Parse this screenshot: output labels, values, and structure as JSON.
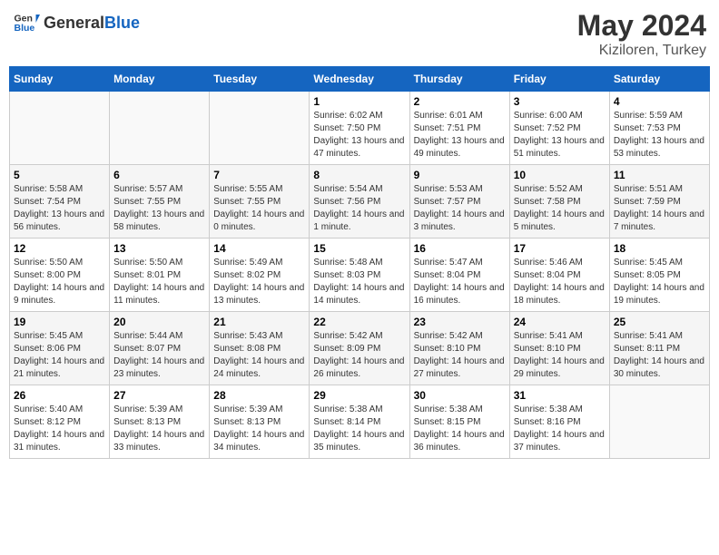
{
  "header": {
    "logo": {
      "general": "General",
      "blue": "Blue"
    },
    "title": "May 2024",
    "location": "Kiziloren, Turkey"
  },
  "weekdays": [
    "Sunday",
    "Monday",
    "Tuesday",
    "Wednesday",
    "Thursday",
    "Friday",
    "Saturday"
  ],
  "weeks": [
    {
      "shade": false,
      "days": [
        {
          "num": "",
          "empty": true
        },
        {
          "num": "",
          "empty": true
        },
        {
          "num": "",
          "empty": true
        },
        {
          "num": "1",
          "sunrise": "6:02 AM",
          "sunset": "7:50 PM",
          "daylight": "13 hours and 47 minutes."
        },
        {
          "num": "2",
          "sunrise": "6:01 AM",
          "sunset": "7:51 PM",
          "daylight": "13 hours and 49 minutes."
        },
        {
          "num": "3",
          "sunrise": "6:00 AM",
          "sunset": "7:52 PM",
          "daylight": "13 hours and 51 minutes."
        },
        {
          "num": "4",
          "sunrise": "5:59 AM",
          "sunset": "7:53 PM",
          "daylight": "13 hours and 53 minutes."
        }
      ]
    },
    {
      "shade": true,
      "days": [
        {
          "num": "5",
          "sunrise": "5:58 AM",
          "sunset": "7:54 PM",
          "daylight": "13 hours and 56 minutes."
        },
        {
          "num": "6",
          "sunrise": "5:57 AM",
          "sunset": "7:55 PM",
          "daylight": "13 hours and 58 minutes."
        },
        {
          "num": "7",
          "sunrise": "5:55 AM",
          "sunset": "7:55 PM",
          "daylight": "14 hours and 0 minutes."
        },
        {
          "num": "8",
          "sunrise": "5:54 AM",
          "sunset": "7:56 PM",
          "daylight": "14 hours and 1 minute."
        },
        {
          "num": "9",
          "sunrise": "5:53 AM",
          "sunset": "7:57 PM",
          "daylight": "14 hours and 3 minutes."
        },
        {
          "num": "10",
          "sunrise": "5:52 AM",
          "sunset": "7:58 PM",
          "daylight": "14 hours and 5 minutes."
        },
        {
          "num": "11",
          "sunrise": "5:51 AM",
          "sunset": "7:59 PM",
          "daylight": "14 hours and 7 minutes."
        }
      ]
    },
    {
      "shade": false,
      "days": [
        {
          "num": "12",
          "sunrise": "5:50 AM",
          "sunset": "8:00 PM",
          "daylight": "14 hours and 9 minutes."
        },
        {
          "num": "13",
          "sunrise": "5:50 AM",
          "sunset": "8:01 PM",
          "daylight": "14 hours and 11 minutes."
        },
        {
          "num": "14",
          "sunrise": "5:49 AM",
          "sunset": "8:02 PM",
          "daylight": "14 hours and 13 minutes."
        },
        {
          "num": "15",
          "sunrise": "5:48 AM",
          "sunset": "8:03 PM",
          "daylight": "14 hours and 14 minutes."
        },
        {
          "num": "16",
          "sunrise": "5:47 AM",
          "sunset": "8:04 PM",
          "daylight": "14 hours and 16 minutes."
        },
        {
          "num": "17",
          "sunrise": "5:46 AM",
          "sunset": "8:04 PM",
          "daylight": "14 hours and 18 minutes."
        },
        {
          "num": "18",
          "sunrise": "5:45 AM",
          "sunset": "8:05 PM",
          "daylight": "14 hours and 19 minutes."
        }
      ]
    },
    {
      "shade": true,
      "days": [
        {
          "num": "19",
          "sunrise": "5:45 AM",
          "sunset": "8:06 PM",
          "daylight": "14 hours and 21 minutes."
        },
        {
          "num": "20",
          "sunrise": "5:44 AM",
          "sunset": "8:07 PM",
          "daylight": "14 hours and 23 minutes."
        },
        {
          "num": "21",
          "sunrise": "5:43 AM",
          "sunset": "8:08 PM",
          "daylight": "14 hours and 24 minutes."
        },
        {
          "num": "22",
          "sunrise": "5:42 AM",
          "sunset": "8:09 PM",
          "daylight": "14 hours and 26 minutes."
        },
        {
          "num": "23",
          "sunrise": "5:42 AM",
          "sunset": "8:10 PM",
          "daylight": "14 hours and 27 minutes."
        },
        {
          "num": "24",
          "sunrise": "5:41 AM",
          "sunset": "8:10 PM",
          "daylight": "14 hours and 29 minutes."
        },
        {
          "num": "25",
          "sunrise": "5:41 AM",
          "sunset": "8:11 PM",
          "daylight": "14 hours and 30 minutes."
        }
      ]
    },
    {
      "shade": false,
      "days": [
        {
          "num": "26",
          "sunrise": "5:40 AM",
          "sunset": "8:12 PM",
          "daylight": "14 hours and 31 minutes."
        },
        {
          "num": "27",
          "sunrise": "5:39 AM",
          "sunset": "8:13 PM",
          "daylight": "14 hours and 33 minutes."
        },
        {
          "num": "28",
          "sunrise": "5:39 AM",
          "sunset": "8:13 PM",
          "daylight": "14 hours and 34 minutes."
        },
        {
          "num": "29",
          "sunrise": "5:38 AM",
          "sunset": "8:14 PM",
          "daylight": "14 hours and 35 minutes."
        },
        {
          "num": "30",
          "sunrise": "5:38 AM",
          "sunset": "8:15 PM",
          "daylight": "14 hours and 36 minutes."
        },
        {
          "num": "31",
          "sunrise": "5:38 AM",
          "sunset": "8:16 PM",
          "daylight": "14 hours and 37 minutes."
        },
        {
          "num": "",
          "empty": true
        }
      ]
    }
  ]
}
